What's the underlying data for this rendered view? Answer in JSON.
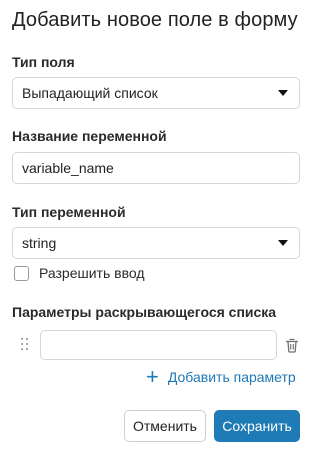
{
  "dialog": {
    "title": "Добавить новое поле в форму"
  },
  "field_type": {
    "label": "Тип поля",
    "selected": "Выпадающий список"
  },
  "variable_name": {
    "label": "Название переменной",
    "value": "variable_name"
  },
  "variable_type": {
    "label": "Тип переменной",
    "selected": "string"
  },
  "allow_input": {
    "label": "Разрешить ввод",
    "checked": false
  },
  "dropdown_params": {
    "label": "Параметры раскрывающегося списка",
    "items": [
      {
        "value": ""
      }
    ],
    "add_label": "Добавить параметр",
    "add_icon": "+"
  },
  "actions": {
    "cancel_label": "Отменить",
    "save_label": "Сохранить"
  },
  "colors": {
    "accent": "#1e7bb5",
    "link": "#1e78b6",
    "border": "#d6d6d6"
  }
}
